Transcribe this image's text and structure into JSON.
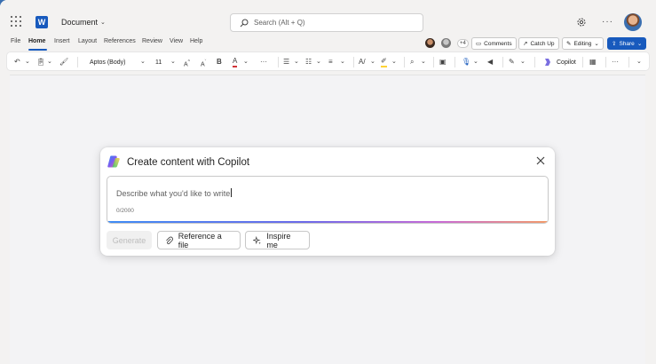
{
  "titlebar": {
    "document_title": "Document",
    "search_placeholder": "Search (Alt + Q)"
  },
  "menu": {
    "items": [
      "File",
      "Home",
      "Insert",
      "Layout",
      "References",
      "Review",
      "View",
      "Help"
    ],
    "active": "Home"
  },
  "collab": {
    "extra_count": "+4",
    "comments_label": "Comments",
    "catchup_label": "Catch Up",
    "editing_label": "Editing",
    "share_label": "Share"
  },
  "ribbon": {
    "font_name": "Aptos (Body)",
    "font_size": "11",
    "copilot_label": "Copilot"
  },
  "copilot_dialog": {
    "title": "Create content with Copilot",
    "prompt_placeholder": "Describe what you'd like to write",
    "char_counter": "0/2000",
    "generate_label": "Generate",
    "reference_label": "Reference a file",
    "inspire_label": "Inspire me"
  },
  "colors": {
    "accent": "#185abd",
    "font_color_underline": "#d13438",
    "highlight_underline": "#ffd335"
  },
  "icons": {
    "app": "word-icon",
    "waffle": "app-launcher-icon",
    "settings": "gear-icon",
    "close": "close-icon"
  }
}
